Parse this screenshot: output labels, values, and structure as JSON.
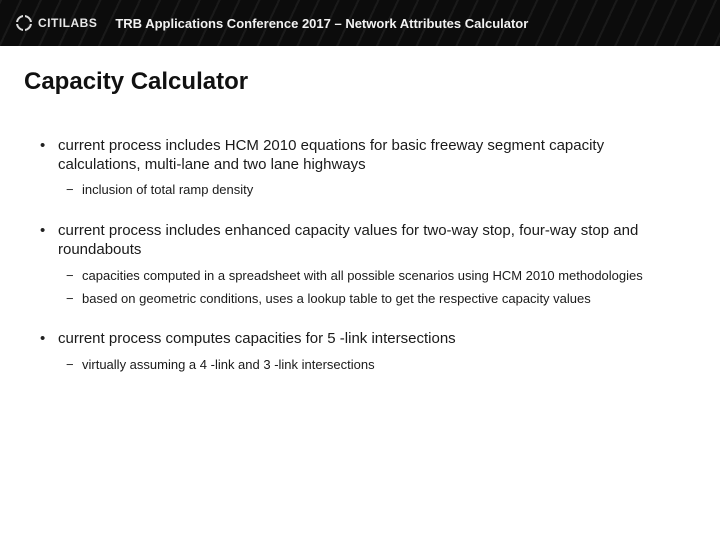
{
  "header": {
    "brand": "CITILABS",
    "title": "TRB Applications Conference 2017 – Network Attributes Calculator"
  },
  "slide": {
    "title": "Capacity Calculator",
    "bullets": [
      {
        "text": "current process includes HCM 2010 equations for basic freeway segment capacity calculations, multi-lane and two lane highways",
        "sub": [
          "inclusion of total ramp density"
        ]
      },
      {
        "text": "current process includes enhanced capacity values for two-way stop, four-way stop and roundabouts",
        "sub": [
          "capacities computed in a spreadsheet with all possible scenarios using HCM 2010 methodologies",
          "based on geometric conditions, uses a lookup table to get the respective capacity values"
        ]
      },
      {
        "text": "current process computes capacities for 5 -link intersections",
        "sub": [
          "virtually assuming a 4 -link and 3 -link intersections"
        ]
      }
    ]
  }
}
